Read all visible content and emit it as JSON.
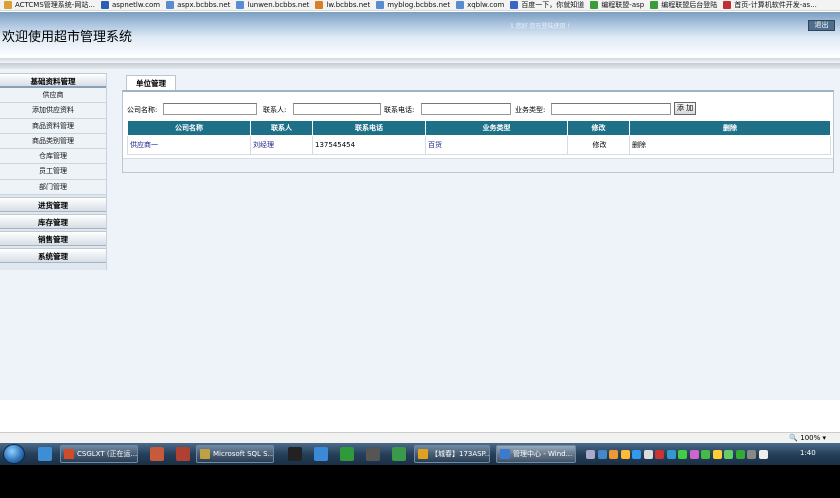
{
  "browser": {
    "favorites": [
      {
        "label": "ACTCMS管理系统-网站...",
        "color": "#d9a036"
      },
      {
        "label": "aspnetlw.com",
        "color": "#2b5fb5"
      },
      {
        "label": "aspx.bcbbs.net",
        "color": "#5b8bd0"
      },
      {
        "label": "lunwen.bcbbs.net",
        "color": "#5b8bd0"
      },
      {
        "label": "lw.bcbbs.net",
        "color": "#d97f2a"
      },
      {
        "label": "myblog.bcbbs.net",
        "color": "#5b8bd0"
      },
      {
        "label": "xqblw.com",
        "color": "#5b8bd0"
      },
      {
        "label": "百度一下，你就知道",
        "color": "#3a64c8"
      },
      {
        "label": "编程联盟-asp",
        "color": "#3a9c3a"
      },
      {
        "label": "编程联盟后台登陆",
        "color": "#3a9c3a"
      },
      {
        "label": "首页-计算机软件开发-as...",
        "color": "#c03030"
      }
    ],
    "zoom": "100%"
  },
  "header": {
    "title": "欢迎使用超市管理系统",
    "welcome": "1 您好 您在登陆使用 !",
    "logout_label": "退出"
  },
  "sidebar": {
    "sections": [
      {
        "label": "基础资料管理",
        "items": [
          "供应商",
          "添加供应资料",
          "商品资料管理",
          "商品类别管理",
          "仓库管理",
          "员工管理",
          "部门管理"
        ]
      },
      {
        "label": "进货管理"
      },
      {
        "label": "库存管理"
      },
      {
        "label": "销售管理"
      },
      {
        "label": "系统管理"
      }
    ]
  },
  "content": {
    "tab_label": "单位管理",
    "search": {
      "company_label": "公司名称:",
      "contact_label": "联系人:",
      "phone_label": "联系电话:",
      "business_label": "业务类型:",
      "add_label": "添 加"
    },
    "table": {
      "headers": [
        "公司名称",
        "联系人",
        "联系电话",
        "业务类型",
        "修改",
        "删除"
      ],
      "rows": [
        {
          "company": "供应商一",
          "contact": "刘经理",
          "phone": "137545454",
          "business": "百货",
          "edit": "修改",
          "delete": "删除"
        }
      ]
    }
  },
  "taskbar": {
    "items": [
      {
        "label": "CSGLXT (正在运...",
        "color": "#d04b2a"
      },
      {
        "label": "Microsoft SQL S...",
        "color": "#c0a040"
      },
      {
        "label": "【城春】173ASP...",
        "color": "#e0a020"
      },
      {
        "label": "管理中心 - Wind...",
        "color": "#3a7ad0"
      }
    ],
    "clock": "1:40"
  }
}
